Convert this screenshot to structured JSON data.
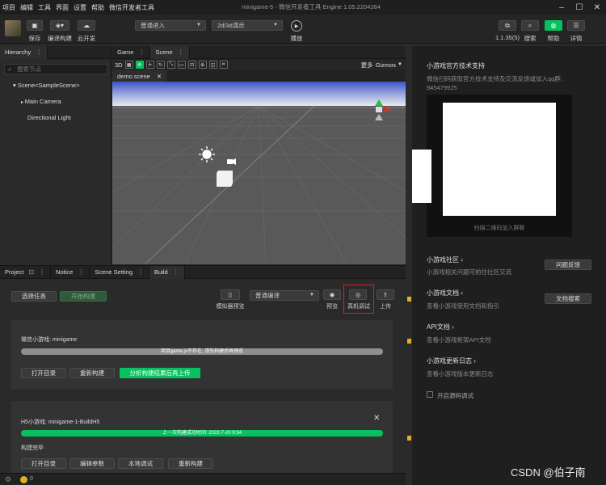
{
  "menu": [
    "项目",
    "编辑",
    "工具",
    "界面",
    "设置",
    "帮助",
    "微信开发者工具"
  ],
  "window_title": "minigame-5 - 微信开发者工具 Engine 1.05.2204264",
  "toolbar": {
    "save": "保存",
    "compile_build": "编译构建",
    "cloud_dev": "云开发",
    "mode_select": "普通进入",
    "dim_select": "2d/3d演示",
    "play": "播放",
    "version": "1.1.35(5)",
    "search": "搜索",
    "help": "帮助",
    "details": "详情"
  },
  "hierarchy": {
    "tab": "Hierarchy",
    "search_placeholder": "搜索节点",
    "scene": "Scene<SampleScene>",
    "camera": "Main Camera",
    "light": "Directional Light"
  },
  "scene_panel": {
    "tabs": [
      "Game",
      "Scene"
    ],
    "mode_3d": "3D",
    "more": "更多",
    "gizmos": "Gizmos",
    "file_tab": "demo.scene"
  },
  "bottom_tabs": [
    "Project",
    "Notice",
    "Scene Setting",
    "Build"
  ],
  "build": {
    "select_task": "选择任务",
    "start_build": "开始构建",
    "simulator_preview": "模拟器预览",
    "compile_select": "普通编译",
    "preview": "预览",
    "real_debug": "真机调试",
    "upload": "上传",
    "card1": {
      "title": "微信小游戏: minigame",
      "bar_text": "项目game.js不存在, 请先构建后再预览",
      "open_dir": "打开目录",
      "rebuild": "重新构建",
      "analyze": "分析构建结果后再上传"
    },
    "card2": {
      "title": "H5小游戏: minigame-1-BuildH5",
      "bar_text": "上一次构建成功时间: 2022-7-20 9:34",
      "status": "构建完毕",
      "open_dir": "打开目录",
      "edit_params": "编辑参数",
      "local_debug": "本地调试",
      "rebuild": "重新构建"
    }
  },
  "right_panel": {
    "support_title": "小游戏官方技术支持",
    "support_desc": "微信扫码获取官方技术支持及交流反馈或加入qq群:",
    "qq": "945479925",
    "qr_caption": "扫描二维码加入群聊",
    "community": "小游戏社区",
    "community_desc": "小游戏相关问题可前往社区交流",
    "feedback": "问题反馈",
    "docs": "小游戏文档",
    "docs_desc": "查看小游戏使用文档和指引",
    "doc_search": "文档搜索",
    "api": "API文档",
    "api_desc": "查看小游戏框架API文档",
    "changelog": "小游戏更新日志",
    "changelog_desc": "查看小游戏版本更新日志",
    "debug_label": "开启源码调试"
  },
  "statusbar": {
    "count": "0"
  },
  "watermark": "CSDN @伯子南",
  "colors": {
    "accent": "#07c160",
    "highlight": "#e02020"
  }
}
